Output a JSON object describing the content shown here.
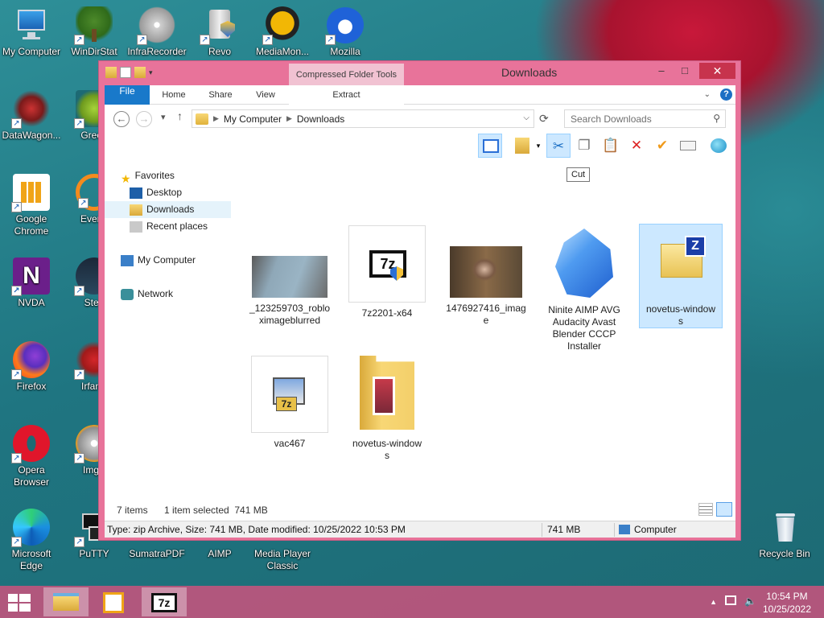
{
  "desktop": {
    "icons": [
      {
        "label": "My Computer",
        "shortcut": false
      },
      {
        "label": "WinDirStat",
        "shortcut": true
      },
      {
        "label": "InfraRecorder",
        "shortcut": true
      },
      {
        "label": "Revo",
        "shortcut": true
      },
      {
        "label": "MediaMon...",
        "shortcut": true
      },
      {
        "label": "Mozilla",
        "shortcut": true
      },
      {
        "label": "DataWagon...",
        "shortcut": true
      },
      {
        "label": "Green",
        "shortcut": true
      },
      {
        "label": "Google Chrome",
        "shortcut": true
      },
      {
        "label": "Everyt",
        "shortcut": true
      },
      {
        "label": "NVDA",
        "shortcut": true
      },
      {
        "label": "Stea",
        "shortcut": true
      },
      {
        "label": "Firefox",
        "shortcut": true
      },
      {
        "label": "IrfanV",
        "shortcut": true
      },
      {
        "label": "Opera Browser",
        "shortcut": true
      },
      {
        "label": "ImgB",
        "shortcut": true
      },
      {
        "label": "Microsoft Edge",
        "shortcut": true
      },
      {
        "label": "PuTTY",
        "shortcut": true
      },
      {
        "label": "SumatraPDF",
        "shortcut": true
      },
      {
        "label": "AIMP",
        "shortcut": true
      },
      {
        "label": "Media Player Classic",
        "shortcut": true
      },
      {
        "label": "Recycle Bin",
        "shortcut": false
      }
    ]
  },
  "window": {
    "title": "Downloads",
    "contextual_group": "Compressed Folder Tools",
    "tabs": [
      "File",
      "Home",
      "Share",
      "View",
      "Extract"
    ],
    "minimize": "–",
    "maximize": "□",
    "close": "✕",
    "help": "?",
    "ribbon_toggle": "⌄"
  },
  "nav": {
    "back": "←",
    "forward": "→",
    "recent": "▾",
    "up": "↑",
    "breadcrumb": [
      "My Computer",
      "Downloads"
    ],
    "crumb_sep": "▶",
    "search_placeholder": "Search Downloads",
    "refresh": "⟳",
    "search_glyph": "⚲",
    "dropdown": "⌵"
  },
  "tooltip": "Cut",
  "nav_pane": {
    "favorites": "Favorites",
    "desktop": "Desktop",
    "downloads": "Downloads",
    "recent": "Recent places",
    "computer": "My Computer",
    "network": "Network"
  },
  "files": [
    {
      "name": "_123259703_robloximageblurred",
      "line1": "_123259703_roblo",
      "line2": "ximageblurred",
      "line3": "",
      "line4": ""
    },
    {
      "name": "7z2201-x64",
      "line1": "7z2201-x64",
      "line2": "",
      "line3": "",
      "line4": ""
    },
    {
      "name": "1476927416_image",
      "line1": "1476927416_imag",
      "line2": "e",
      "line3": "",
      "line4": ""
    },
    {
      "name": "Ninite AIMP AVG Audacity Avast Blender CCCP Installer",
      "line1": "Ninite AIMP AVG",
      "line2": "Audacity Avast",
      "line3": "Blender CCCP",
      "line4": "Installer"
    },
    {
      "name": "novetus-windows",
      "line1": "novetus-window",
      "line2": "s",
      "line3": "",
      "line4": "",
      "selected": true
    },
    {
      "name": "vac467",
      "line1": "vac467",
      "line2": "",
      "line3": "",
      "line4": ""
    },
    {
      "name": "novetus-windows",
      "line1": "novetus-window",
      "line2": "s",
      "line3": "",
      "line4": ""
    }
  ],
  "status": {
    "count": "7 items",
    "selection": "1 item selected  741 MB"
  },
  "details": {
    "type_info": "Type: zip Archive, Size: 741 MB, Date modified: 10/25/2022 10:53 PM",
    "size": "741 MB",
    "location": "Computer"
  },
  "taskbar": {
    "time": "10:54 PM",
    "date": "10/25/2022",
    "tray_arrow": "▲",
    "items": [
      "File Explorer",
      "Launcher",
      "7-Zip"
    ]
  }
}
